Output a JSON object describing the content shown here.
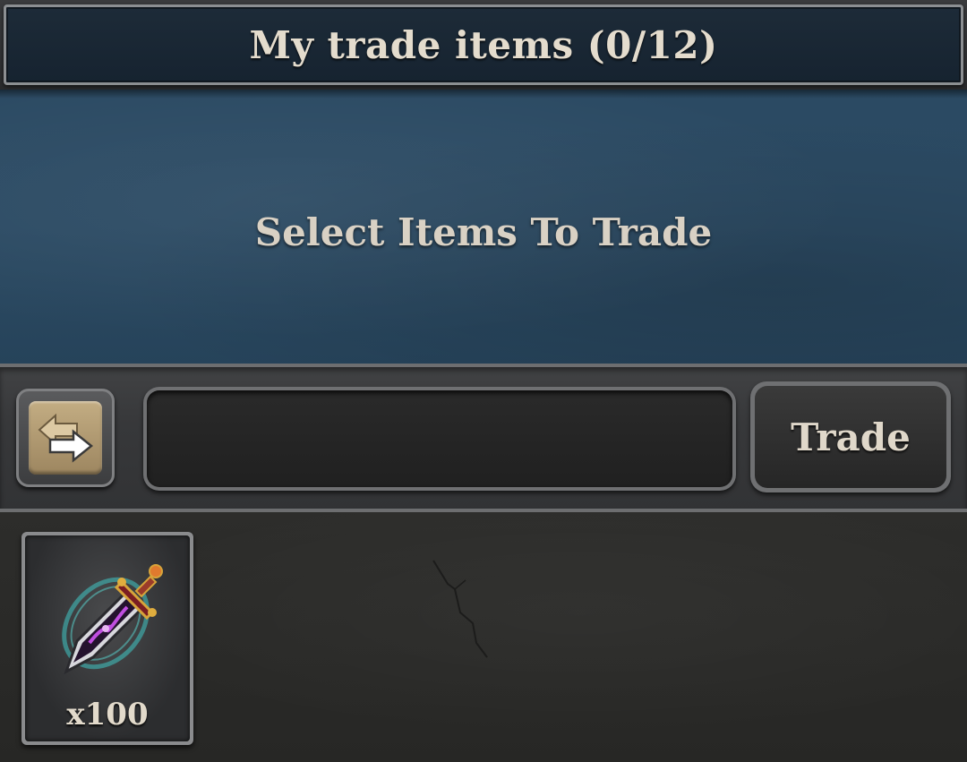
{
  "header": {
    "title": "My trade items (0/12)"
  },
  "trade_panel": {
    "empty_message": "Select Items To Trade"
  },
  "controls": {
    "swap_icon": "swap-arrows-icon",
    "input_value": "",
    "trade_label": "Trade"
  },
  "inventory": {
    "items": [
      {
        "icon": "sword-icon",
        "quantity": "x100"
      }
    ]
  },
  "colors": {
    "header_bg": "#1d2b38",
    "trade_panel_bg": "#2c4b64",
    "control_strip_bg": "#37383a",
    "inventory_bg": "#2a2a28",
    "text": "#ddd5c8",
    "swap_button_face": "#b39c74"
  }
}
